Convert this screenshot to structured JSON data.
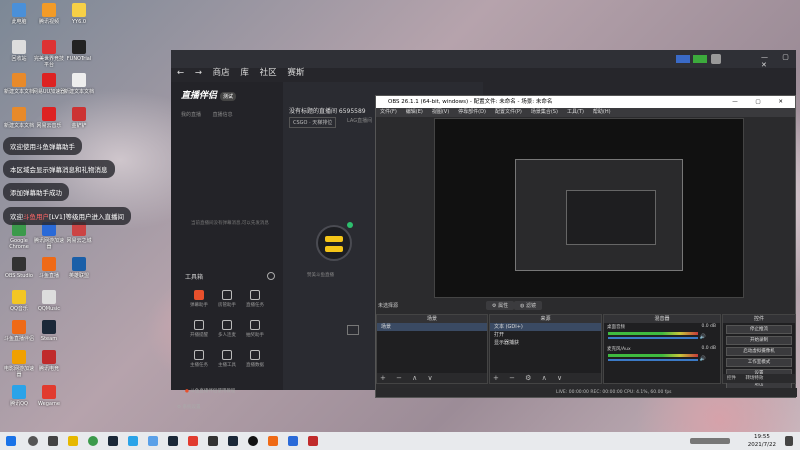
{
  "desktop": {
    "icons": [
      {
        "label": "此电脑",
        "col": 0,
        "row": 0,
        "color": "#4a90d9"
      },
      {
        "label": "腾讯视频",
        "col": 1,
        "row": 0,
        "color": "#f39b27"
      },
      {
        "label": "YY6.0",
        "col": 2,
        "row": 0,
        "color": "#f7d046"
      },
      {
        "label": "回收站",
        "col": 0,
        "row": 1,
        "color": "#ddd"
      },
      {
        "label": "完美世界竞技平台",
        "col": 1,
        "row": 1,
        "color": "#d33"
      },
      {
        "label": "FUNOTrial",
        "col": 2,
        "row": 1,
        "color": "#222"
      },
      {
        "label": "新建文本文档",
        "col": 0,
        "row": 2,
        "color": "#e88a2a"
      },
      {
        "label": "网易UU加速器",
        "col": 1,
        "row": 2,
        "color": "#d22"
      },
      {
        "label": "新建文本文档",
        "col": 2,
        "row": 2,
        "color": "#eee"
      },
      {
        "label": "新建文本文档",
        "col": 0,
        "row": 3,
        "color": "#e88a2a"
      },
      {
        "label": "网易云音乐",
        "col": 1,
        "row": 3,
        "color": "#d22"
      },
      {
        "label": "金铲铲",
        "col": 2,
        "row": 3,
        "color": "#c33"
      },
      {
        "label": "Google Chrome",
        "col": 0,
        "row": 7,
        "color": "#3b9a4b"
      },
      {
        "label": "腾讯网游加速器",
        "col": 1,
        "row": 7,
        "color": "#2a6ad8"
      },
      {
        "label": "网易云之城",
        "col": 2,
        "row": 7,
        "color": "#c44"
      },
      {
        "label": "OBS Studio",
        "col": 0,
        "row": 8,
        "color": "#333"
      },
      {
        "label": "斗鱼直播",
        "col": 1,
        "row": 8,
        "color": "#ef6a16"
      },
      {
        "label": "英雄联盟",
        "col": 2,
        "row": 8,
        "color": "#1a5fa8"
      },
      {
        "label": "QQ音乐",
        "col": 0,
        "row": 9,
        "color": "#f3c623"
      },
      {
        "label": "QQMusic",
        "col": 1,
        "row": 9,
        "color": "#ddd"
      },
      {
        "label": "斗鱼直播伴侣",
        "col": 0,
        "row": 10,
        "color": "#ef6a16"
      },
      {
        "label": "Steam",
        "col": 1,
        "row": 10,
        "color": "#1b2838"
      },
      {
        "label": "电影网游加速器",
        "col": 0,
        "row": 11,
        "color": "#f0a000"
      },
      {
        "label": "腾讯电竞",
        "col": 1,
        "row": 11,
        "color": "#c02b2b"
      },
      {
        "label": "腾讯QQ",
        "col": 0,
        "row": 12,
        "color": "#2aa3e8"
      },
      {
        "label": "Wegame",
        "col": 1,
        "row": 12,
        "color": "#e13b2f"
      }
    ]
  },
  "toasts": [
    {
      "text": "欢迎使用斗鱼弹幕助手",
      "highlight": ""
    },
    {
      "text": "本区域会显示弹幕消息和礼物消息",
      "highlight": ""
    },
    {
      "text": "添加弹幕助手成功",
      "highlight": ""
    },
    {
      "pre": "欢迎",
      "highlight": "斗鱼用户",
      "post": "[LV1]等级用户进入直播间"
    }
  ],
  "assistant": {
    "nav": [
      "商店",
      "库",
      "社区",
      "赛斯"
    ],
    "brand": "直播伴侣",
    "version": "测试",
    "tabs": [
      "我的直播",
      "直播信息"
    ],
    "room_title": "没有标题的直播间 6595589",
    "category": "CSGO · 天梯排位",
    "scene_hint": "LAG直播间",
    "empty_hint": "当前直播间没有弹幕消息,可以先发消息",
    "download_hint": "赞美斗鱼直播",
    "tools_title": "工具箱",
    "tools": [
      {
        "label": "弹幕助手",
        "active": true
      },
      {
        "label": "房管助手",
        "active": false
      },
      {
        "label": "直播任务",
        "active": false
      },
      {
        "label": "开播提醒",
        "active": false
      },
      {
        "label": "多人连麦",
        "active": false
      },
      {
        "label": "抽奖助手",
        "active": false
      },
      {
        "label": "主播任务",
        "active": false
      },
      {
        "label": "主播工具",
        "active": false
      },
      {
        "label": "直播数据",
        "active": false
      }
    ],
    "footer_hint": "斗鱼直播伴侣使用教程",
    "settings": "系统设置"
  },
  "obs": {
    "title": "OBS 26.1.1 (64-bit, windows) - 配置文件: 未命名 - 场景: 未命名",
    "menu": [
      "文件(F)",
      "编辑(E)",
      "视图(V)",
      "停靠部件(D)",
      "配置文件(P)",
      "场景集合(S)",
      "工具(T)",
      "帮助(H)"
    ],
    "tabs": [
      "未选择源",
      "属性",
      "滤镜"
    ],
    "docks": {
      "scenes": "场景",
      "sources": "来源",
      "mixer": "混音器",
      "controls": "控件"
    },
    "scene_items": [
      "场景"
    ],
    "source_items": [
      "文本 (GDI+)",
      "打开",
      "显示器捕获"
    ],
    "mixer_items": [
      {
        "name": "桌面音频",
        "db": "0.0 dB"
      },
      {
        "name": "麦克风/Aux",
        "db": "0.0 dB"
      }
    ],
    "controls": [
      "停止推流",
      "开始录制",
      "启动虚拟摄像机",
      "工作室模式",
      "设置",
      "退出"
    ],
    "control_tabs": [
      "控件",
      "转场特效"
    ],
    "status": "LIVE: 00:00:00   REC: 00:00:00   CPU: 4.1%, 60.00 fps"
  },
  "taskbar": {
    "time": "19:55",
    "date": "2021/7/22"
  }
}
